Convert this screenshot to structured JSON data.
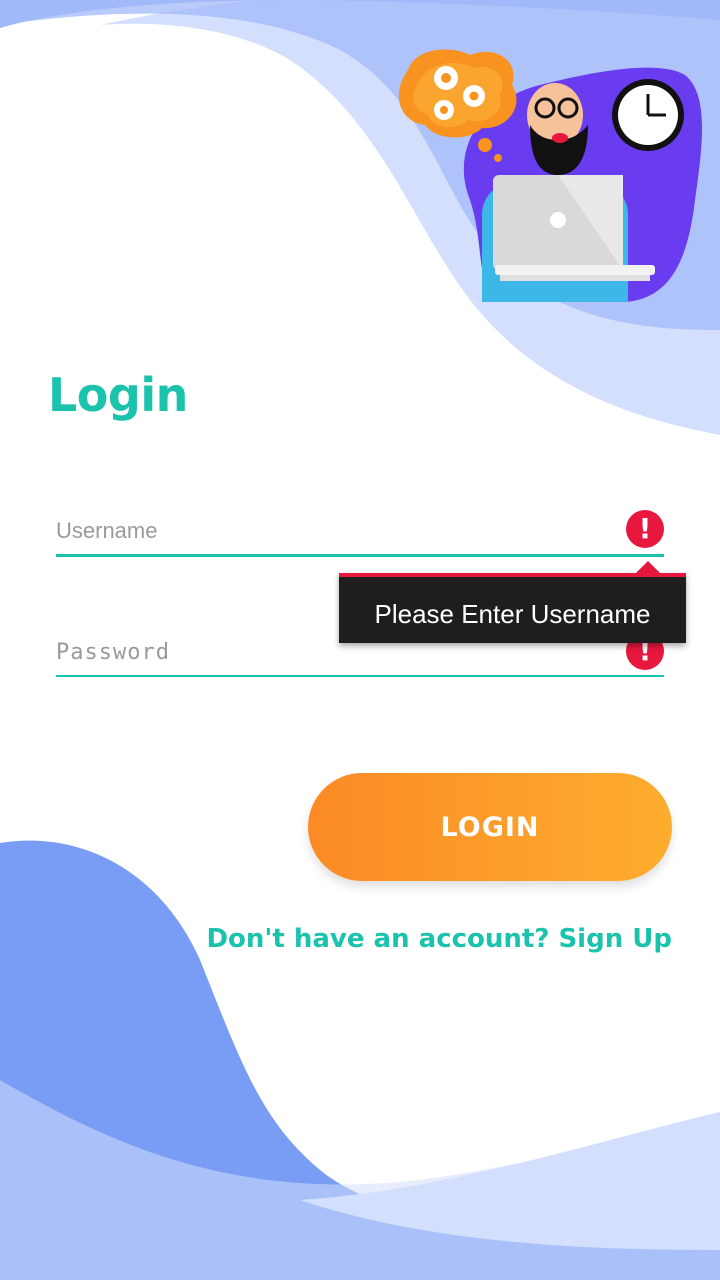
{
  "login_title": "Login",
  "username_field": {
    "placeholder": "Username",
    "value": "",
    "error_icon": "!"
  },
  "password_field": {
    "placeholder": "Password",
    "value": "",
    "error_icon": "!"
  },
  "error_tooltip": {
    "text": "Please Enter Username"
  },
  "login_button": {
    "label": "LOGIN"
  },
  "signup_link": {
    "text": "Don't have an account? Sign Up"
  },
  "colors": {
    "accent_teal": "#1bc3ad",
    "error_red": "#e8173e",
    "button_orange_start": "#fc8a26",
    "button_orange_end": "#fdad2e",
    "wave_blue_light": "#d3dffc",
    "wave_blue": "#a1b9f9",
    "wave_blue_dark": "#7095f5",
    "blob_purple": "#6a3cf0"
  },
  "illustration": {
    "icons": [
      "gears-thought-bubble-icon",
      "clock-icon",
      "bearded-man-laptop-illustration"
    ]
  }
}
